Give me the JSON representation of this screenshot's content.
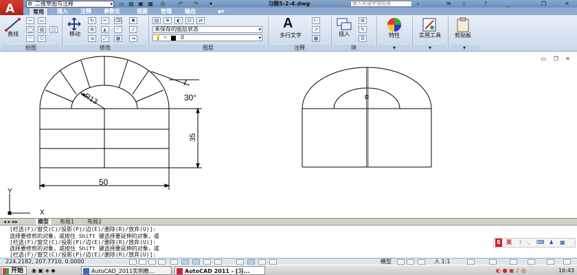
{
  "window": {
    "title": "习题5-2-4.dwg",
    "workspace": "二维草图与注释",
    "help_search_placeholder": "键入关键字或短语"
  },
  "ribbon_tabs": [
    "常用",
    "插入",
    "注释",
    "参数化",
    "视图",
    "管理",
    "输出"
  ],
  "active_tab": "常用",
  "ribbon": {
    "draw_line_label": "直线",
    "modify_move_label": "移动",
    "layer_state": "未保存的图层状态",
    "layer_current": "0",
    "mtext_label": "多行文字",
    "insert_label": "插入",
    "properties_label": "特性",
    "utilities_label": "实用工具",
    "clipboard_label": "剪贴板",
    "panels": [
      "绘图",
      "修改",
      "图层",
      "注释",
      "块"
    ]
  },
  "drawing": {
    "dims": {
      "radius": "R13",
      "angle": "30°",
      "height": "35",
      "width": "50"
    },
    "ucs": {
      "x_label": "X",
      "y_label": "Y"
    }
  },
  "layout_tabs": [
    "模型",
    "布局1",
    "布局2"
  ],
  "active_layout": "模型",
  "command_lines": [
    "[栏选(F)/窗交(C)/投影(P)/边(E)/删除(R)/放弃(U)]:",
    "选择要修剪的对象，或按住 Shift 键选择要延伸的对象，或",
    "[栏选(F)/窗交(C)/投影(P)/边(E)/删除(R)/放弃(U)]:",
    "选择要修剪的对象，或按住 Shift 键选择要延伸的对象，或",
    "[栏选(F)/窗交(C)/投影(P)/边(E)/删除(R)/放弃(U)]:"
  ],
  "status": {
    "coords": "224.2182,  207.7710,  0.0000",
    "model_label": "模型",
    "annotation_scale": "人 1:1"
  },
  "ime": {
    "label": "英"
  },
  "taskbar": {
    "start": "开始",
    "tasks": [
      "AutoCAD_2011实例教...",
      "AutoCAD 2011 - [习..."
    ],
    "clock": "16:43"
  }
}
